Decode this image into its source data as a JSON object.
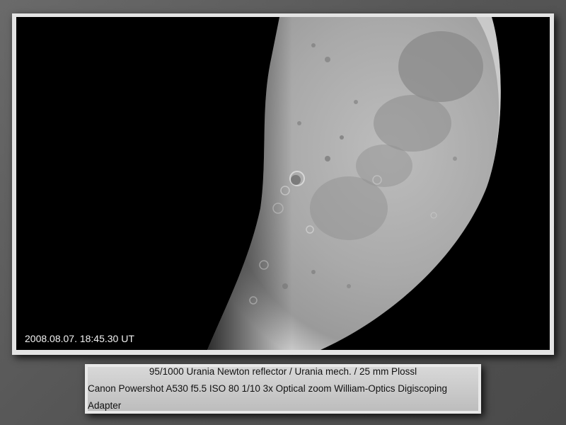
{
  "photo": {
    "timestamp": "2008.08.07.  18:45.30 UT"
  },
  "caption": {
    "line1": "95/1000 Urania Newton reflector / Urania mech. / 25 mm Plossl",
    "line2": "Canon Powershot A530 f5.5 ISO 80 1/10 3x Optical zoom William-Optics Digiscoping Adapter"
  },
  "colors": {
    "background": "#5e5e5e",
    "sky": "#000000",
    "moon_light": "#c8c8c8",
    "caption_bg": "#cfcfcf"
  }
}
